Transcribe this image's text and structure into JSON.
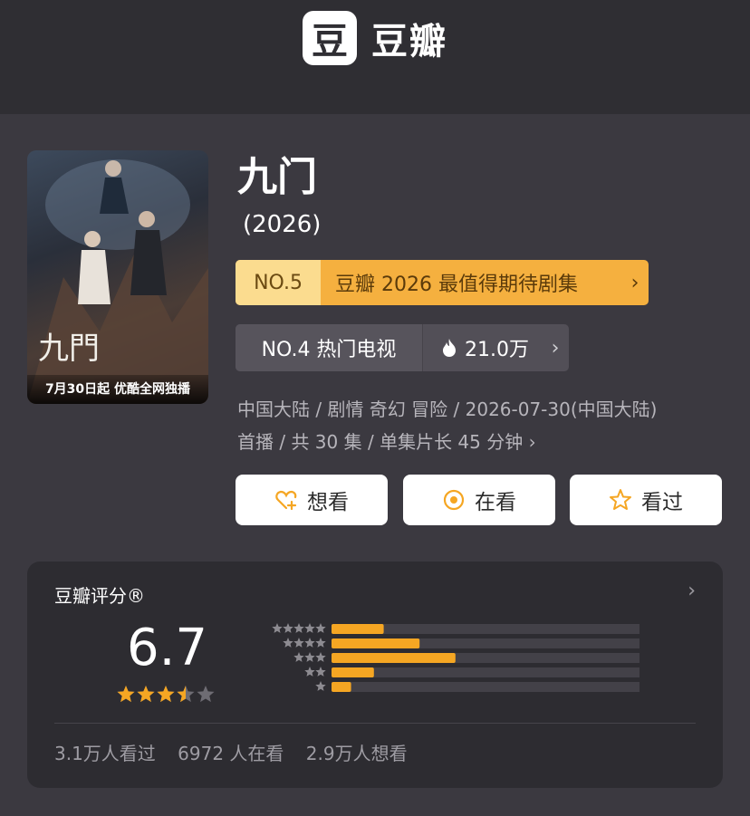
{
  "header": {
    "logo_glyph": "豆",
    "brand_name": "豆瓣"
  },
  "show": {
    "title": "九门",
    "year": "(2026)",
    "poster_logo_text": "九門",
    "poster_caption": "7月30日起 优酷全网独播"
  },
  "ranking_primary": {
    "rank": "NO.5",
    "label": "豆瓣 2026 最值得期待剧集",
    "chevron": "›"
  },
  "ranking_hot": {
    "rank": "NO.4 热门电视",
    "heat": "21.0万",
    "chevron": "›"
  },
  "meta": {
    "line1": "中国大陆 / 剧情 奇幻 冒险 / 2026-07-30(中国大陆)",
    "line2": "首播 / 共 30 集 / 单集片长 45 分钟",
    "chevron": "›"
  },
  "actions": [
    {
      "label": "想看",
      "icon": "heart-plus-icon"
    },
    {
      "label": "在看",
      "icon": "target-icon"
    },
    {
      "label": "看过",
      "icon": "star-outline-icon"
    }
  ],
  "rating": {
    "title": "豆瓣评分®",
    "chevron": "›",
    "score": "6.7",
    "stars": 3.5,
    "distribution": [
      {
        "stars": 5,
        "fraction": 0.16
      },
      {
        "stars": 4,
        "fraction": 0.27
      },
      {
        "stars": 3,
        "fraction": 0.38
      },
      {
        "stars": 2,
        "fraction": 0.13
      },
      {
        "stars": 1,
        "fraction": 0.06
      }
    ],
    "stats": [
      "3.1万人看过",
      "6972 人在看",
      "2.9万人想看"
    ]
  },
  "colors": {
    "accent": "#f5a623",
    "rank_badge_bg": "#f5b03f",
    "page_bg": "#3b3940",
    "card_bg": "#2d2c31"
  }
}
